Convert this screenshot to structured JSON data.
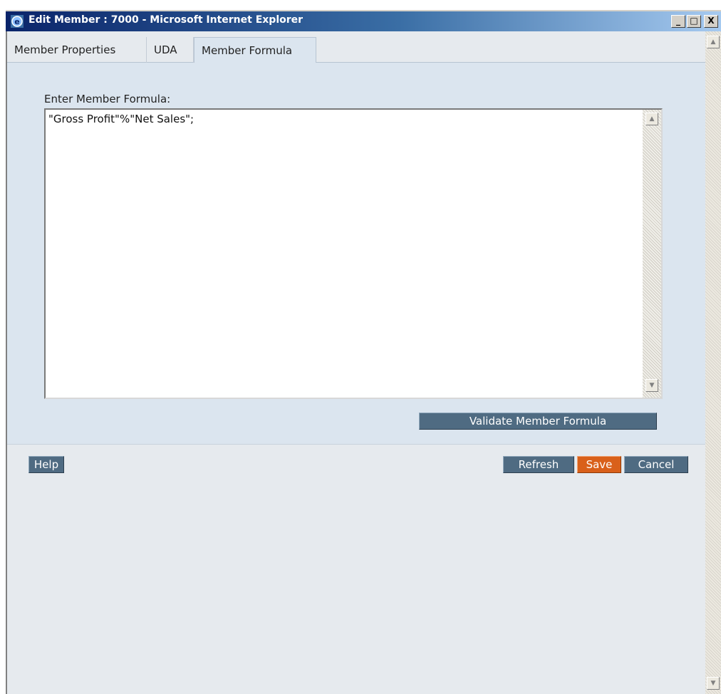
{
  "window": {
    "title": "Edit Member : 7000 - Microsoft Internet Explorer",
    "controls": {
      "minimize": "_",
      "maximize": "□",
      "close": "X"
    }
  },
  "tabs": [
    {
      "label": "Member Properties",
      "active": false
    },
    {
      "label": "UDA",
      "active": false
    },
    {
      "label": "Member Formula",
      "active": true
    }
  ],
  "formula": {
    "label": "Enter Member Formula:",
    "value": "\"Gross Profit\"%\"Net Sales\";"
  },
  "buttons": {
    "validate": "Validate Member Formula",
    "help": "Help",
    "refresh": "Refresh",
    "save": "Save",
    "cancel": "Cancel"
  },
  "colors": {
    "panel": "#dbe5ef",
    "button": "#4f6b82",
    "save_button": "#d9601a"
  }
}
